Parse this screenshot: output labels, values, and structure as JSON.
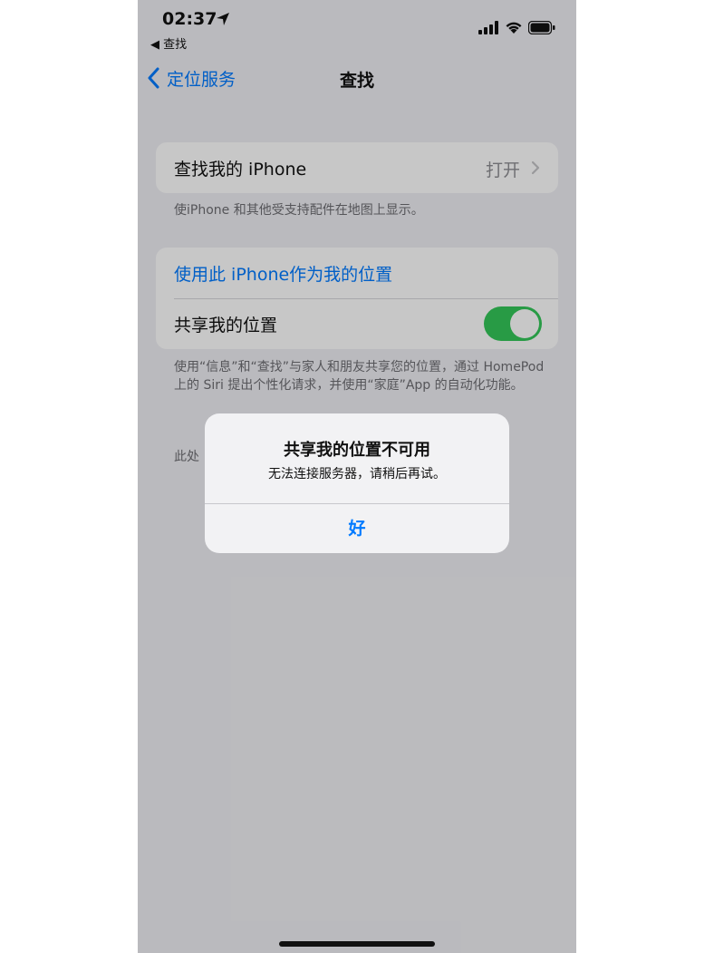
{
  "status": {
    "time": "02:37",
    "back_app": "◀ 查找"
  },
  "nav": {
    "back_label": "定位服务",
    "title": "查找"
  },
  "group1": {
    "find_my_label": "查找我的 iPhone",
    "find_my_value": "打开",
    "footer": "使iPhone 和其他受支持配件在地图上显示。"
  },
  "group2": {
    "use_this_label": "使用此 iPhone作为我的位置",
    "share_label": "共享我的位置",
    "share_on": true,
    "footer": "使用“信息”和“查找”与家人和朋友共享您的位置，通过 HomePod上的 Siri 提出个性化请求，并使用“家庭”App 的自动化功能。",
    "footer2": "此处"
  },
  "alert": {
    "title": "共享我的位置不可用",
    "message": "无法连接服务器，请稍后再试。",
    "ok_label": "好"
  },
  "colors": {
    "accent": "#007aff",
    "toggle_on": "#34c759"
  }
}
